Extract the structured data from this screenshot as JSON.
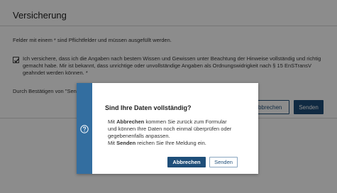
{
  "page": {
    "title": "Versicherung",
    "required_note": "Felder mit einem * sind Pflichtfelder und müssen ausgefüllt werden.",
    "consent": {
      "checked": true,
      "text": "Ich versichere, dass ich die Angaben nach bestem Wissen und Gewissen unter Beachtung der Hinweise vollständig und richtig gemacht habe. Mir ist bekannt, dass unrichtige oder unvollständige Angaben als Ordnungswidrigkeit nach § 15 EnSTransV geahndet werden können. *"
    },
    "confirm_text": "Durch Bestätigen von \"Senden",
    "buttons": {
      "cancel_label": "Abbrechen",
      "send_label": "Senden"
    }
  },
  "dialog": {
    "icon": "question-circle-icon",
    "title": "Sind Ihre Daten vollständig?",
    "line1_prefix": "Mit ",
    "line1_bold": "Abbrechen",
    "line1_rest": " kommen Sie zurück zum Formular und können Ihre Daten noch einmal überprüfen oder gegebenenfalls anpassen.",
    "line2_prefix": "Mit ",
    "line2_bold": "Senden",
    "line2_rest": " reichen Sie Ihre Meldung ein.",
    "buttons": {
      "cancel_label": "Abbrechen",
      "send_label": "Senden"
    }
  },
  "colors": {
    "primary": "#1e4e79",
    "dialog_bar": "#336ea0"
  }
}
